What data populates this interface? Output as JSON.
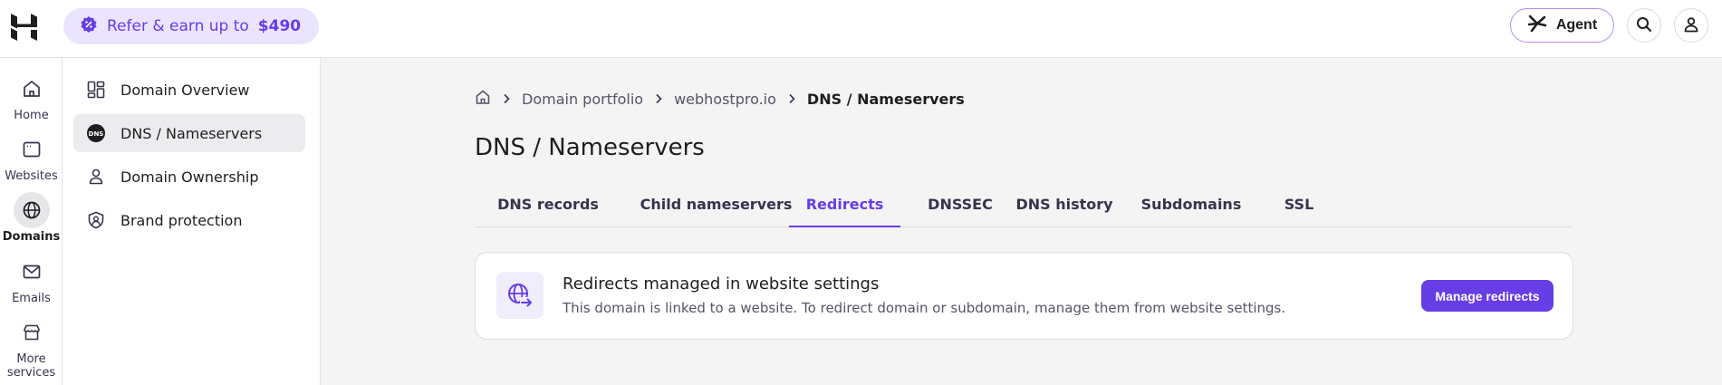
{
  "topbar": {
    "refer": {
      "text": "Refer & earn up to",
      "amount": "$490"
    },
    "agent_label": "Agent"
  },
  "rail": {
    "items": [
      {
        "label": "Home",
        "icon": "home-icon"
      },
      {
        "label": "Websites",
        "icon": "browser-window-icon"
      },
      {
        "label": "Domains",
        "icon": "globe-icon",
        "active": true
      },
      {
        "label": "Emails",
        "icon": "mail-icon"
      },
      {
        "label": "More services",
        "label_line1": "More",
        "label_line2": "services",
        "icon": "store-icon"
      }
    ]
  },
  "subnav": {
    "items": [
      {
        "label": "Domain Overview",
        "icon": "dashboard-icon"
      },
      {
        "label": "DNS / Nameservers",
        "icon": "dns-icon",
        "active": true
      },
      {
        "label": "Domain Ownership",
        "icon": "person-icon"
      },
      {
        "label": "Brand protection",
        "icon": "shield-icon"
      }
    ]
  },
  "breadcrumb": {
    "items": [
      "Domain portfolio",
      "webhostpro.io"
    ],
    "current": "DNS / Nameservers"
  },
  "page": {
    "title": "DNS / Nameservers"
  },
  "tabs": [
    {
      "label": "DNS records"
    },
    {
      "label": "Child nameservers"
    },
    {
      "label": "Redirects",
      "active": true
    },
    {
      "label": "DNSSEC"
    },
    {
      "label": "DNS history"
    },
    {
      "label": "Subdomains"
    },
    {
      "label": "SSL"
    }
  ],
  "card": {
    "icon": "globe-redirect-icon",
    "title": "Redirects managed in website settings",
    "description": "This domain is linked to a website. To redirect domain or subdomain, manage them from website settings.",
    "button_label": "Manage redirects"
  },
  "colors": {
    "accent": "#673de6",
    "accent_soft": "#ebe4ff",
    "text": "#1d1e20",
    "background": "#f4f4f4"
  }
}
